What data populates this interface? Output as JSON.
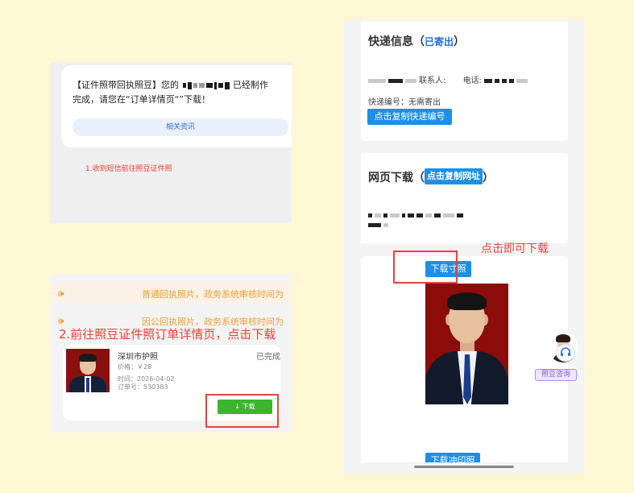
{
  "sms": {
    "line1_prefix": "【证件照带回执照豆】您的",
    "line1_suffix": "已经制作",
    "line2": "完成，请您在“订单详情页“”下载！",
    "related_button": "相关资讯",
    "step_label": "1.收到短信前往照豆证件照"
  },
  "order": {
    "notice1": "普通回执照片，政务系统审核时间为",
    "notice2": "因公回执照片，政务系统审核时间为",
    "step_label": "2.前往照豆证件照订单详情页，点击下载",
    "name": "深圳市护照",
    "status": "已完成",
    "price": "价格：￥28",
    "time": "时间：2026-04-02",
    "order_no": "订单号：530383",
    "download_button": "↓ 下载"
  },
  "express": {
    "title": "快递信息（",
    "status": "已寄出",
    "title_end": "）",
    "contact_label": "联系人:",
    "phone_label": "电话:",
    "tracking_text": "快递编号：无需寄出",
    "copy_tracking_button": "点击复制快递编号"
  },
  "web_download": {
    "title": "网页下载（",
    "copy_url_button": "点击复制网址",
    "title_end": "）"
  },
  "photo": {
    "callout": "点击即可下载",
    "download_size_button": "下载寸照",
    "download_print_button": "下载冲印照"
  },
  "customer_service": {
    "label": "照豆咨询"
  },
  "icons": {
    "speaker": "speaker-icon",
    "headset": "headset-icon",
    "download": "download-icon"
  },
  "colors": {
    "background": "#fdf7d4",
    "accent_red": "#e8433a",
    "button_blue": "#1d8fe8",
    "download_green": "#3cb52e",
    "notice_orange": "#f0a135"
  }
}
